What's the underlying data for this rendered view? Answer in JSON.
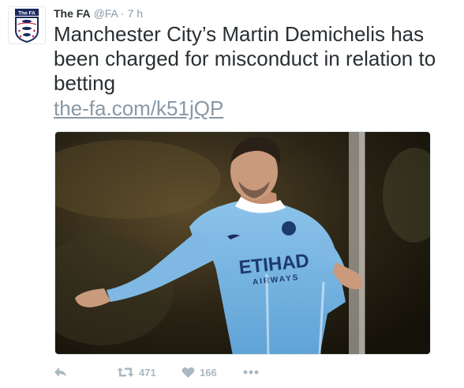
{
  "tweet": {
    "author_name": "The FA",
    "handle": "@FA",
    "separator": "·",
    "time": "7 h",
    "text": "Manchester City’s Martin Demichelis has been charged for misconduct in relation to betting",
    "link": "the-fa.com/k51jQP",
    "avatar": {
      "logo_text": "The FA",
      "icon": "three-lions-crest-icon"
    },
    "media": {
      "jersey_text": "ETIHAD",
      "jersey_subtext": "AIRWAYS"
    },
    "actions": {
      "reply_icon": "reply-icon",
      "retweet_icon": "retweet-icon",
      "retweet_count": "471",
      "like_icon": "heart-icon",
      "like_count": "166",
      "more_icon": "more-dots-icon"
    }
  },
  "colors": {
    "text": "#292f33",
    "meta": "#8899a6",
    "action": "#aab8c2",
    "jersey": "#6cabdd"
  }
}
